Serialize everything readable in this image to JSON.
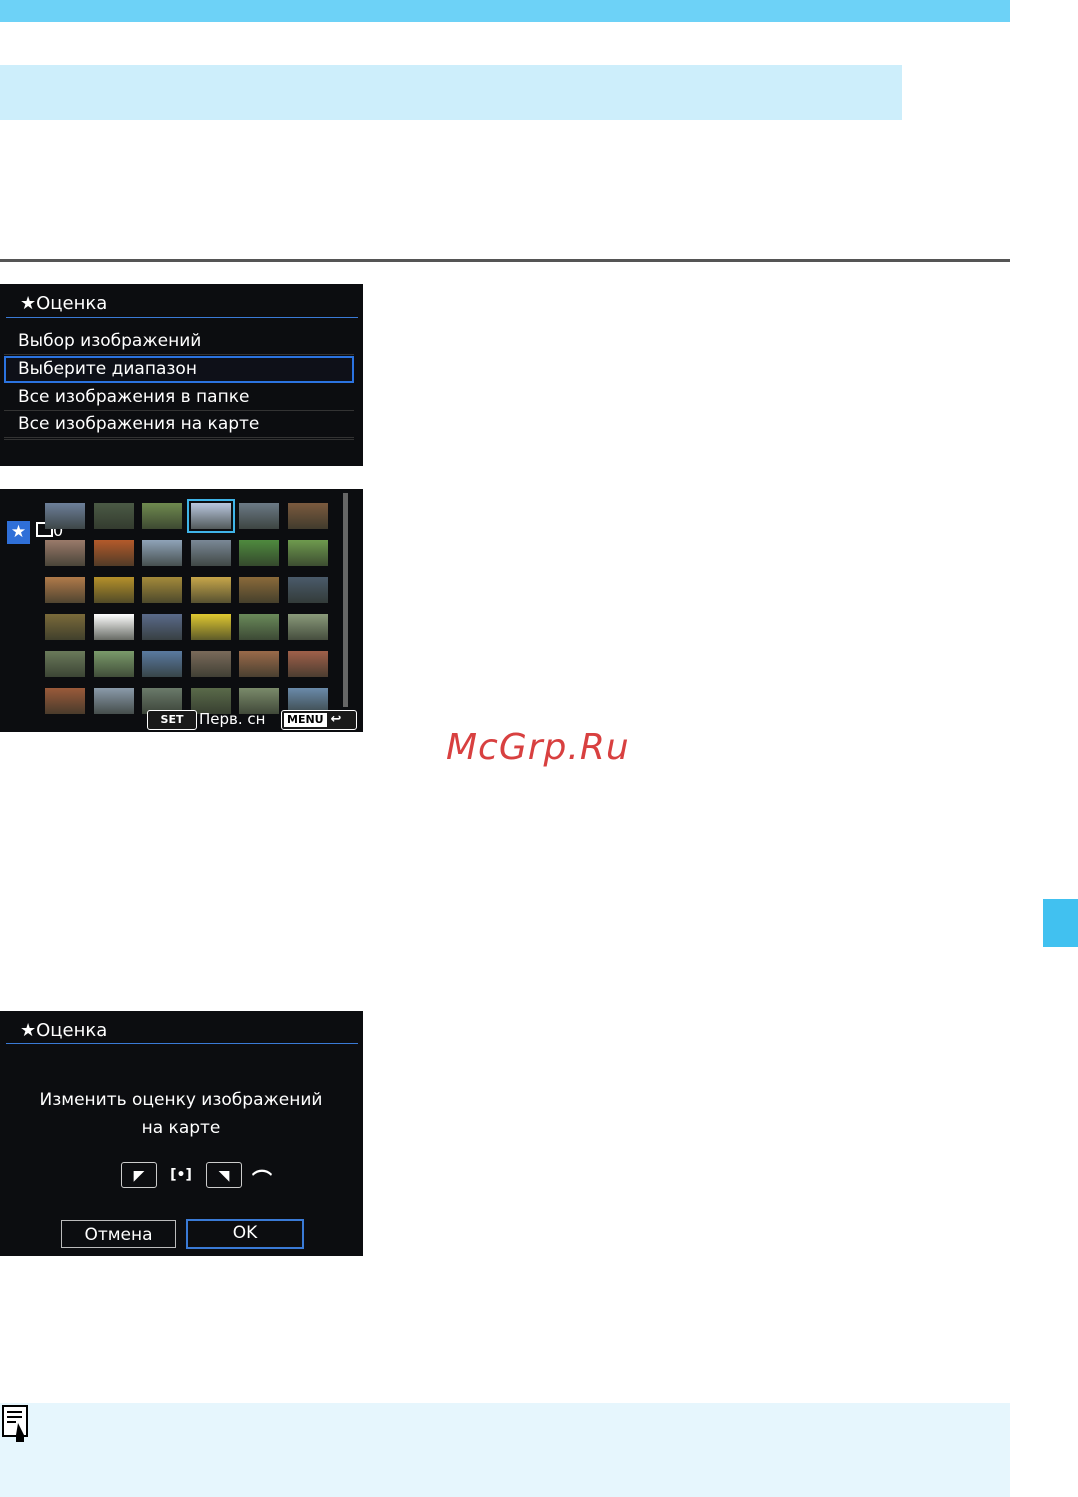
{
  "menu_screen": {
    "title": "★Оценка",
    "items": [
      "Выбор изображений",
      "Выберите диапазон",
      "Все изображения в папке",
      "Все изображения на карте"
    ],
    "selected_index": 1
  },
  "range_screen": {
    "star_icon": "★",
    "folder_count": "0",
    "set_key": "SET",
    "first_image_label": "Перв. сн",
    "menu_key": "MENU",
    "back_glyph": "↩",
    "thumb_colors": [
      [
        "#6d7f9a",
        "#4b5a45",
        "#6f8a4f",
        "#b9c7df",
        "#6c7a86",
        "#7b5a3e"
      ],
      [
        "#9a7a6a",
        "#b45a2a",
        "#8fa3b8",
        "#7a8896",
        "#4f8a3e",
        "#6e9a4e"
      ],
      [
        "#b07a4a",
        "#b5902a",
        "#a48a3a",
        "#c7a64a",
        "#8a6a3a",
        "#4a5a6a"
      ],
      [
        "#7a6a3a",
        "#ffffff",
        "#5a6a8a",
        "#e0c830",
        "#6a8a5a",
        "#8a9a7a"
      ],
      [
        "#6a7a5a",
        "#7a9a6a",
        "#5a7aa0",
        "#7a6a5a",
        "#9a6a4a",
        "#a0604a"
      ],
      [
        "#9a5a3a",
        "#8a9aaa",
        "#6a7a6a",
        "#5a6a4a",
        "#7a8a6a",
        "#6a8aaa"
      ]
    ],
    "highlighted_thumb": [
      0,
      3
    ]
  },
  "confirm_screen": {
    "title": "★Оценка",
    "message_line1": "Изменить оценку изображений",
    "message_line2": "на карте",
    "rating_keys": [
      "◤",
      "[•]",
      "◥"
    ],
    "dial_glyph": "⌒",
    "cancel_label": "Отмена",
    "ok_label": "OK"
  },
  "watermark": "McGrp.Ru",
  "colors": {
    "header_bar": "#6dd2f7",
    "subheader_bar": "#cdeefb",
    "side_tab": "#41c1f0",
    "note_bg": "#e6f6fd",
    "accent_blue": "#2b73e0"
  }
}
